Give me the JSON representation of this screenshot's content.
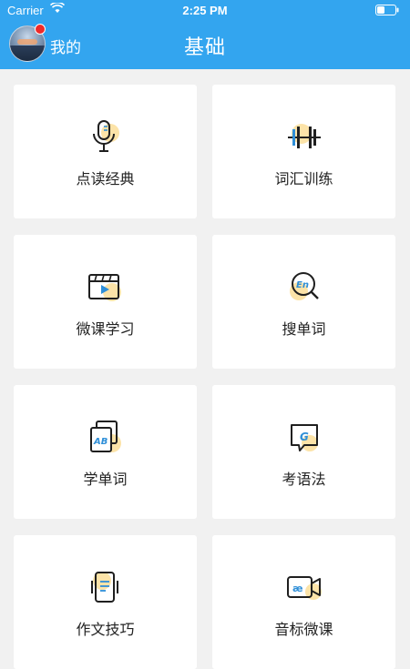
{
  "status": {
    "carrier": "Carrier",
    "time": "2:25 PM"
  },
  "nav": {
    "me_label": "我的",
    "title": "基础"
  },
  "colors": {
    "header": "#33a5ef",
    "accent_blob": "#fce3a8",
    "icon_stroke": "#1f1f1f",
    "icon_blue": "#2f8fd8"
  },
  "cards": [
    {
      "label": "点读经典",
      "icon": "microphone-icon"
    },
    {
      "label": "词汇训练",
      "icon": "dumbbell-icon"
    },
    {
      "label": "微课学习",
      "icon": "video-player-icon"
    },
    {
      "label": "搜单词",
      "icon": "search-en-icon"
    },
    {
      "label": "学单词",
      "icon": "ab-cards-icon"
    },
    {
      "label": "考语法",
      "icon": "grammar-g-icon"
    },
    {
      "label": "作文技巧",
      "icon": "writing-phone-icon"
    },
    {
      "label": "音标微课",
      "icon": "phonetic-camera-icon"
    }
  ]
}
